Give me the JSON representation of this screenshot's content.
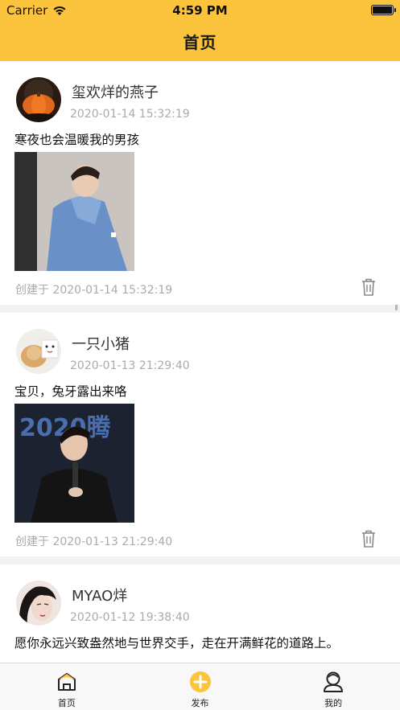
{
  "status_bar": {
    "carrier": "Carrier",
    "time": "4:59 PM"
  },
  "nav": {
    "title": "首页"
  },
  "posts": [
    {
      "username": "玺欢烊的燕子",
      "time": "2020-01-14 15:32:19",
      "content": "寒夜也会温暖我的男孩",
      "created": "创建于 2020-01-14 15:32:19"
    },
    {
      "username": "一只小猪",
      "time": "2020-01-13 21:29:40",
      "content": "宝贝，兔牙露出来咯",
      "created": "创建于 2020-01-13 21:29:40",
      "photo_text": "2020腾"
    },
    {
      "username": "MYAO烊",
      "time": "2020-01-12 19:38:40",
      "content": "愿你永远兴致盎然地与世界交手，走在开满鲜花的道路上。"
    }
  ],
  "tabs": [
    {
      "label": "首页",
      "icon": "home-icon"
    },
    {
      "label": "发布",
      "icon": "plus-circle-icon"
    },
    {
      "label": "我的",
      "icon": "profile-icon"
    }
  ],
  "colors": {
    "accent": "#fcc43c"
  }
}
